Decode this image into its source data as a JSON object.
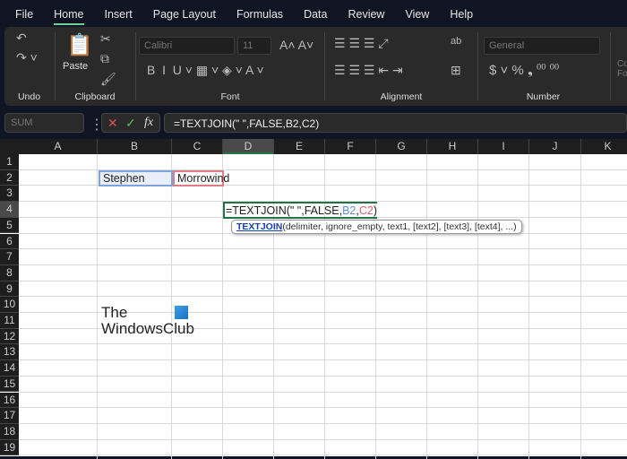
{
  "menu": [
    "File",
    "Home",
    "Insert",
    "Page Layout",
    "Formulas",
    "Data",
    "Review",
    "View",
    "Help"
  ],
  "ribbon": {
    "undo_label": "Undo",
    "clipboard_label": "Clipboard",
    "paste_label": "Paste",
    "font_label": "Font",
    "font_name": "Calibri",
    "font_size": "11",
    "alignment_label": "Alignment",
    "number_label": "Number",
    "number_format": "General",
    "partial_next_group": "Co Fo"
  },
  "formula_bar": {
    "name_box": "SUM",
    "fx": "fx",
    "formula": "=TEXTJOIN(\" \",FALSE,B2,C2)"
  },
  "columns": [
    "A",
    "B",
    "C",
    "D",
    "E",
    "F",
    "G",
    "H",
    "I",
    "J",
    "K"
  ],
  "rows": [
    "1",
    "2",
    "3",
    "4",
    "5",
    "6",
    "7",
    "8",
    "9",
    "10",
    "11",
    "12",
    "13",
    "14",
    "15",
    "16",
    "17",
    "18",
    "19"
  ],
  "cells": {
    "B2": "Stephen",
    "C2": "Morrowind",
    "D4": {
      "prefix": "=TEXTJOIN(\" \",FALSE,",
      "ref1": "B2",
      "comma": ",",
      "ref2": "C2",
      "suffix": ")"
    }
  },
  "tooltip": {
    "fn": "TEXTJOIN",
    "args": "(delimiter, ignore_empty, text1, [text2], [text3], [text4], ...)"
  },
  "watermark": {
    "line1": "The",
    "line2": "WindowsClub"
  },
  "colors": {
    "ref1": "#5b8fd6",
    "ref2": "#d9626e",
    "active": "#217346"
  }
}
